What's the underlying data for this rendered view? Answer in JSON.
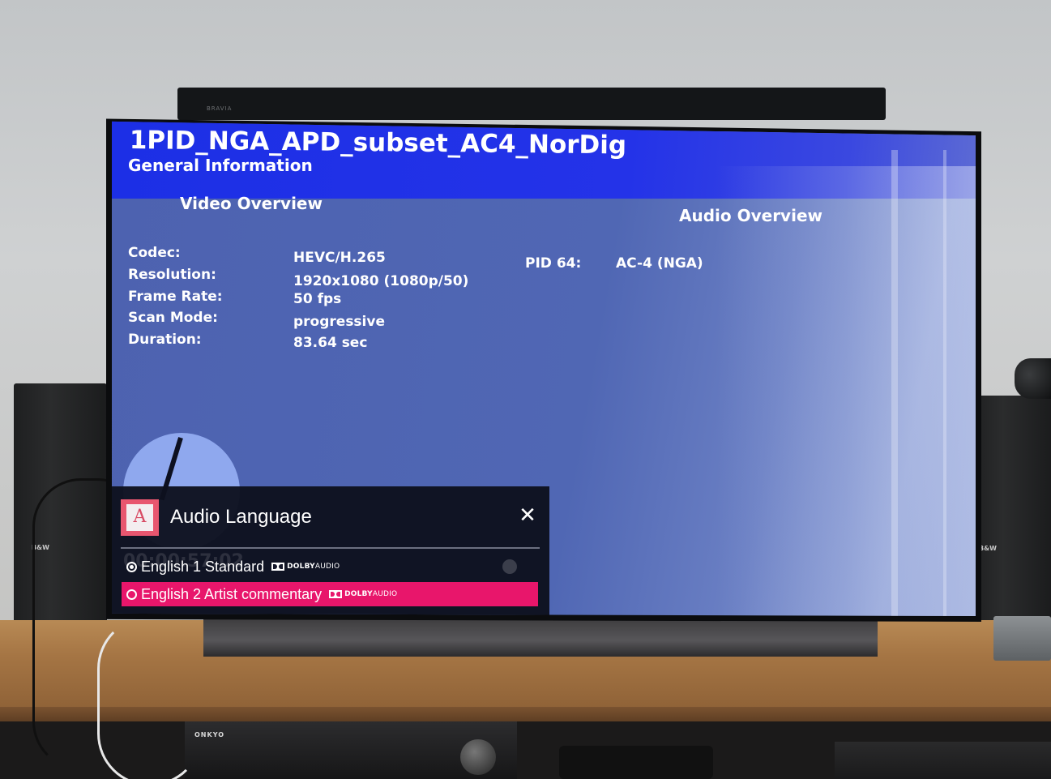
{
  "room": {
    "back_tv_brand": "BRAVIA",
    "left_speaker_badge": "B&W",
    "right_speaker_badge": "B&W",
    "receiver_brand": "ONKYO"
  },
  "screen": {
    "title": "1PID_NGA_APD_subset_AC4_NorDig",
    "subtitle": "General Information",
    "video_heading": "Video Overview",
    "audio_heading": "Audio Overview",
    "video_info": [
      {
        "label": "Codec:",
        "value": "HEVC/H.265"
      },
      {
        "label": "Resolution:",
        "value": "1920x1080 (1080p/50)"
      },
      {
        "label": "Frame Rate:",
        "value": "50 fps"
      },
      {
        "label": "Scan Mode:",
        "value": "progressive"
      },
      {
        "label": "Duration:",
        "value": "83.64 sec"
      }
    ],
    "audio_info": [
      {
        "label": "PID 64:",
        "value": "AC-4 (NGA)"
      }
    ],
    "colors": {
      "header_blue": "#2433e8",
      "screen_blue": "#5067b4",
      "highlight_pink": "#e8166b"
    }
  },
  "audio_language_popup": {
    "icon": "audio-language-icon",
    "icon_glyph": "A",
    "title": "Audio Language",
    "close_icon": "close-icon",
    "close_glyph": "✕",
    "ghost_text": "00:00:57:02",
    "options": [
      {
        "label": "English 1 Standard",
        "badge_bold": "DOLBY",
        "badge_rest": " AUDIO",
        "selected": true,
        "focused": false
      },
      {
        "label": "English 2 Artist commentary",
        "badge_bold": "DOLBY",
        "badge_rest": " AUDIO",
        "selected": false,
        "focused": true
      }
    ]
  }
}
